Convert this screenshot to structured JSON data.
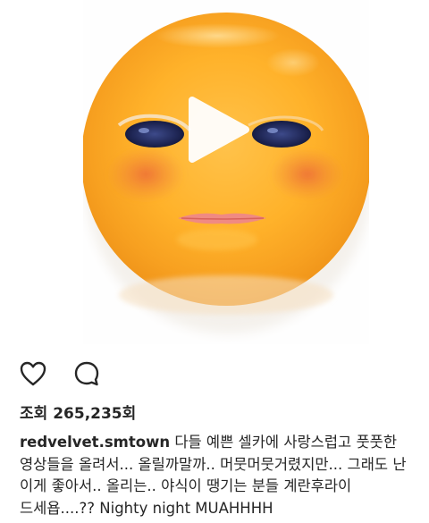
{
  "post": {
    "media": {
      "type": "video",
      "play_icon": "play-icon"
    },
    "actions": {
      "like_icon": "heart-outline-icon",
      "comment_icon": "speech-bubble-icon"
    },
    "views": {
      "label": "조회",
      "count": "265,235회"
    },
    "caption": {
      "username": "redvelvet.smtown",
      "text": "다들 예쁜 셀카에 사랑스럽고 풋풋한 영상들을 올려서... 올릴까말까.. 머뭇머뭇거렸지만... 그래도 난 이게 좋아서.. 올리는.. 야식이 땡기는 분들 계란후라이 드세욥....?? Nighty night MUAHHHH"
    }
  },
  "colors": {
    "yolk_center": "#FFB630",
    "yolk_edge": "#F39A1E",
    "blush": "#F07A3C",
    "lips": "#F0807A",
    "eyes": "#1E2452",
    "text": "#262626"
  }
}
